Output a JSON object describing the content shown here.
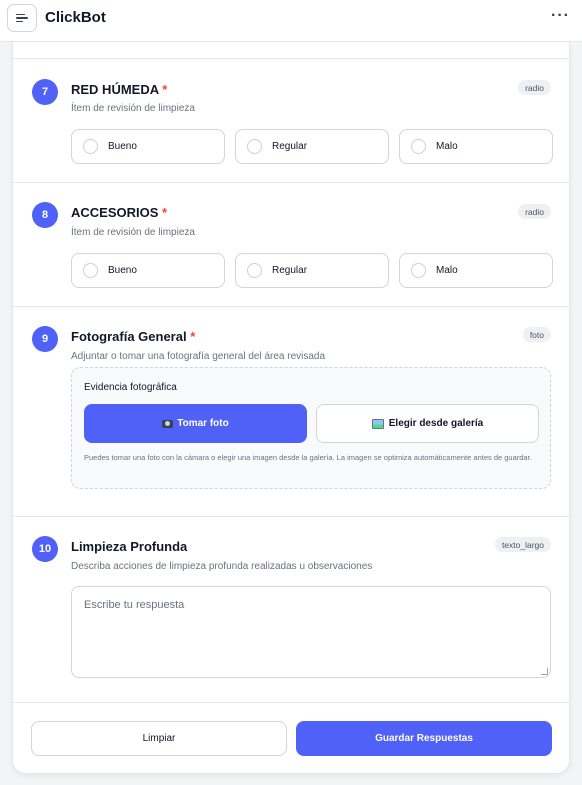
{
  "app": {
    "title": "ClickBot"
  },
  "icons": {
    "menu": "hamburger-menu-icon",
    "more": "more-horizontal-icon",
    "camera": "camera-icon",
    "gallery": "image-gallery-icon"
  },
  "colors": {
    "accent": "#4f61f6",
    "required": "#ef4444"
  },
  "questions": [
    {
      "number": "7",
      "title": "RED HÚMEDA",
      "required_mark": "*",
      "description": "Ítem de revisión de limpieza",
      "type": "radio",
      "options": [
        "Bueno",
        "Regular",
        "Malo"
      ]
    },
    {
      "number": "8",
      "title": "ACCESORIOS",
      "required_mark": "*",
      "description": "Ítem de revisión de limpieza",
      "type": "radio",
      "options": [
        "Bueno",
        "Regular",
        "Malo"
      ]
    },
    {
      "number": "9",
      "title": "Fotografía General",
      "required_mark": "*",
      "description": "Adjuntar o tomar una fotografía general del área revisada",
      "type": "foto",
      "photo": {
        "label": "Evidencia fotográfica",
        "take_label": "Tomar foto",
        "gallery_label": "Elegir desde galería",
        "hint": "Puedes tomar una foto con la cámara o elegir una imagen desde la galería. La imagen se optimiza automáticamente antes de guardar."
      }
    },
    {
      "number": "10",
      "title": "Limpieza Profunda",
      "description": "Describa acciones de limpieza profunda realizadas u observaciones",
      "type": "texto_largo",
      "value": "",
      "placeholder": "Escribe tu respuesta"
    }
  ],
  "actions": {
    "clear_label": "Limpiar",
    "save_label": "Guardar Respuestas"
  }
}
